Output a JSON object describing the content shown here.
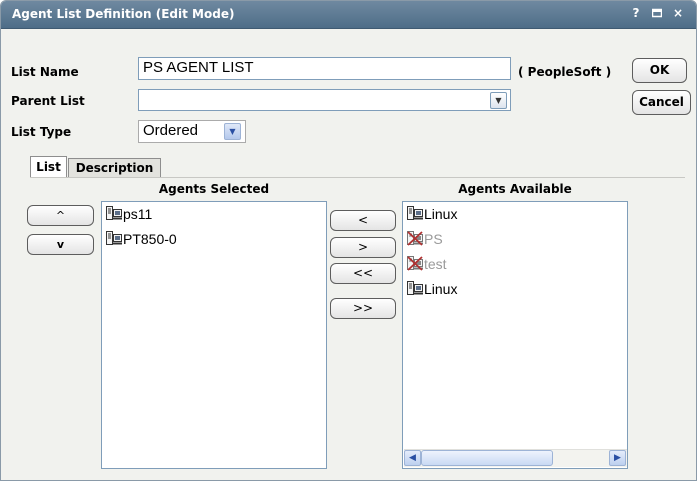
{
  "window": {
    "title": "Agent List Definition (Edit Mode)",
    "help_label": "?",
    "restore_label": "▫",
    "close_label": "×"
  },
  "form": {
    "list_name_label": "List Name",
    "list_name_value": "PS AGENT LIST",
    "source_label": "( PeopleSoft )",
    "parent_list_label": "Parent List",
    "parent_list_value": "",
    "list_type_label": "List Type",
    "list_type_value": "Ordered"
  },
  "buttons": {
    "ok": "OK",
    "cancel": "Cancel",
    "move_up": "^",
    "move_down": "v",
    "add_one": "<",
    "remove_one": ">",
    "add_all": "<<",
    "remove_all": ">>"
  },
  "tabs": [
    {
      "label": "List",
      "active": true
    },
    {
      "label": "Description",
      "active": false
    }
  ],
  "agents_selected": {
    "header": "Agents Selected",
    "items": [
      {
        "label": "ps11",
        "enabled": true,
        "icon": "agent-icon"
      },
      {
        "label": "PT850-0",
        "enabled": true,
        "icon": "agent-icon"
      }
    ]
  },
  "agents_available": {
    "header": "Agents Available",
    "items": [
      {
        "label": "Linux",
        "enabled": true,
        "icon": "agent-icon"
      },
      {
        "label": "PS",
        "enabled": false,
        "icon": "agent-offline-icon"
      },
      {
        "label": "test",
        "enabled": false,
        "icon": "agent-offline-icon"
      },
      {
        "label": "Linux",
        "enabled": true,
        "icon": "agent-icon"
      }
    ]
  },
  "colors": {
    "titlebar": "#5a7892",
    "window_bg": "#f1f2ee",
    "field_border": "#7f9db9",
    "offline_icon": "#b03030"
  }
}
